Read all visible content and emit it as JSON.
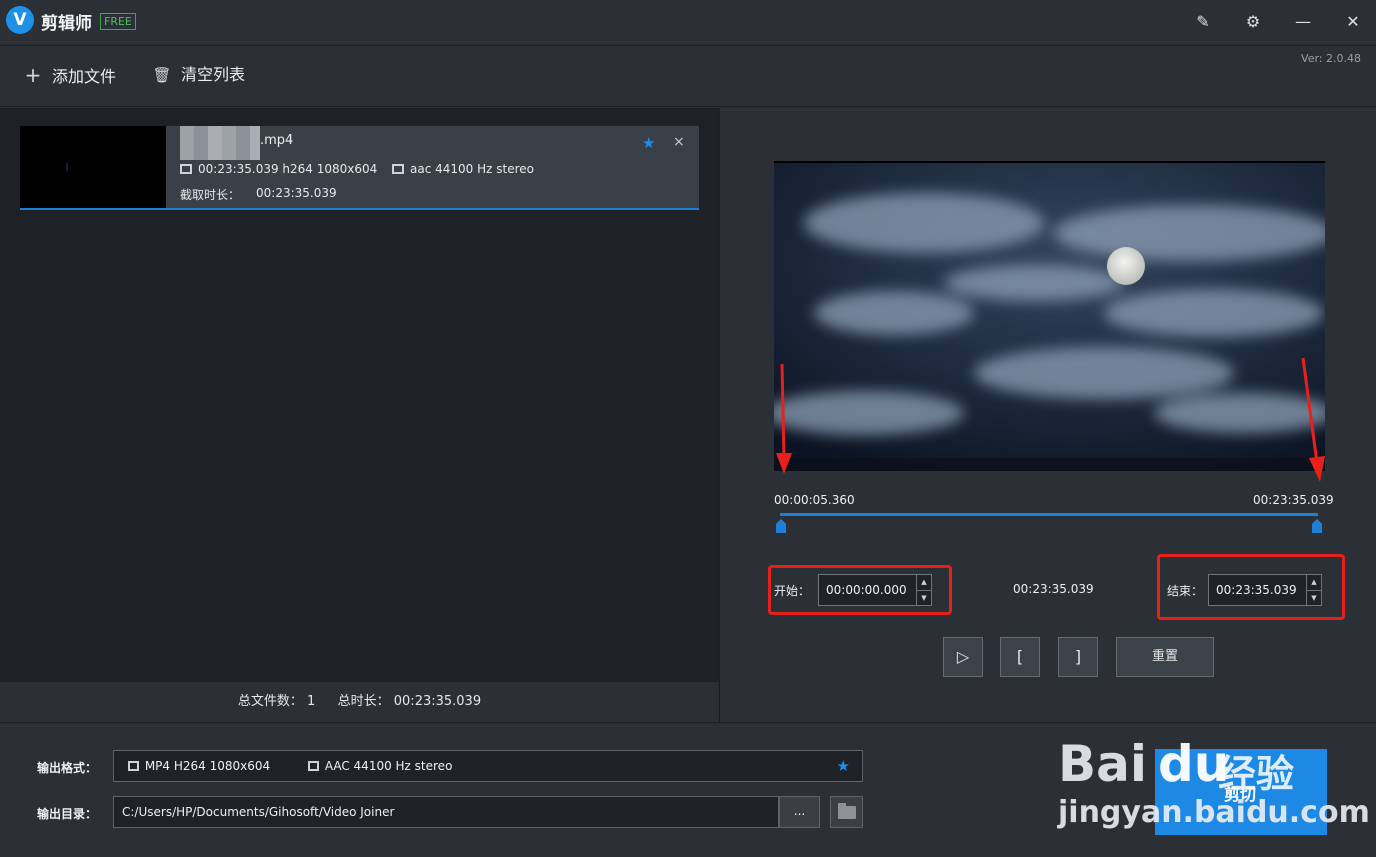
{
  "app": {
    "logo_letter": "V",
    "title": "剪辑师",
    "badge": "FREE",
    "version": "Ver: 2.0.48"
  },
  "window_controls": {
    "edit_icon": "✎",
    "settings_icon": "⚙",
    "minimize_icon": "—",
    "close_icon": "✕"
  },
  "toolbar": {
    "add_files": "添加文件",
    "clear_list": "清空列表",
    "add_icon": "+",
    "trash_icon": "🗑"
  },
  "file_list": [
    {
      "name": ".mp4",
      "video_info": "00:23:35.039 h264 1080x604",
      "audio_info": "aac 44100 Hz stereo",
      "clip_duration_label": "截取时长：",
      "clip_duration": "00:23:35.039",
      "star_icon": "★",
      "close_icon": "×"
    }
  ],
  "stats": {
    "total_files_label": "总文件数：",
    "total_files": "1",
    "total_duration_label": "总时长：",
    "total_duration": "00:23:35.039"
  },
  "player": {
    "range_start": "00:00:05.360",
    "range_end": "00:23:35.039",
    "start_label": "开始：",
    "start_value": "00:00:00.000",
    "duration": "00:23:35.039",
    "end_label": "结束：",
    "end_value": "00:23:35.039",
    "play_icon": "▷",
    "mark_in": "[",
    "mark_out": "]",
    "reset": "重置",
    "spin_up": "▲",
    "spin_down": "▼"
  },
  "output": {
    "format_label": "输出格式：",
    "format_video": "MP4 H264 1080x604",
    "format_audio": "AAC 44100 Hz stereo",
    "dir_label": "输出目录：",
    "dir_value": "C:/Users/HP/Documents/Gihosoft/Video Joiner",
    "browse": "...",
    "star_icon": "★"
  },
  "watermark": {
    "brand": "Bai",
    "brand_du": "du",
    "tag": "经验",
    "sub": "剪切",
    "url": "jingyan.baidu.com"
  },
  "colors": {
    "accent": "#1e7fd6",
    "highlight_box": "#e8201a",
    "free_badge": "#4fc05a"
  }
}
